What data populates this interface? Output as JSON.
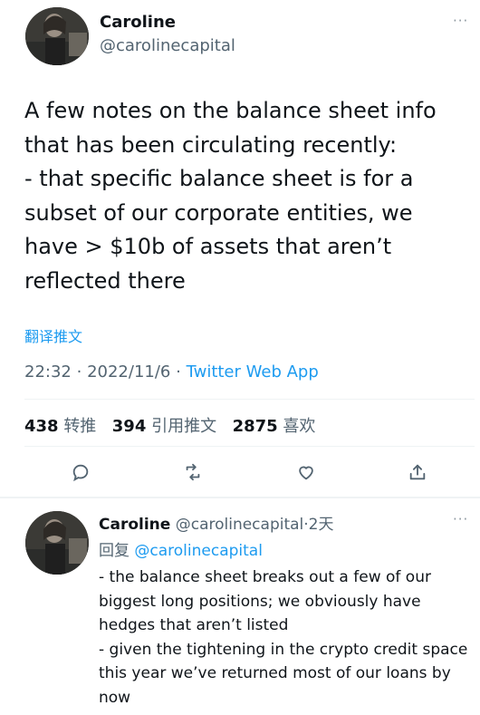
{
  "main_tweet": {
    "name": "Caroline",
    "handle": "@carolinecapital",
    "more": "···",
    "text": "A few notes on the balance sheet info that has been circulating recently:\n- that specific balance sheet is for a subset of our corporate entities, we have > $10b of assets that aren’t reflected there",
    "translate": "翻译推文",
    "time": "22:32",
    "date": "2022/11/6",
    "source": "Twitter Web App",
    "sep": "·",
    "stats": {
      "retweets_count": "438",
      "retweets_label": "转推",
      "quotes_count": "394",
      "quotes_label": "引用推文",
      "likes_count": "2875",
      "likes_label": "喜欢"
    }
  },
  "actions": [
    {
      "icon": "reply-icon"
    },
    {
      "icon": "retweet-icon"
    },
    {
      "icon": "like-icon"
    },
    {
      "icon": "share-icon"
    }
  ],
  "reply_tweet": {
    "name": "Caroline",
    "handle": "@carolinecapital",
    "sep": "·",
    "age": "2天",
    "more": "···",
    "replying_prefix": "回复",
    "replying_to": "@carolinecapital",
    "text": "- the balance sheet breaks out a few of our biggest long positions; we obviously have hedges that aren’t listed\n- given the tightening in the crypto credit space this year we’ve returned most of our loans by now"
  },
  "colors": {
    "link": "#1d9bf0",
    "secondary_text": "#536471",
    "divider": "#eff3f4"
  }
}
